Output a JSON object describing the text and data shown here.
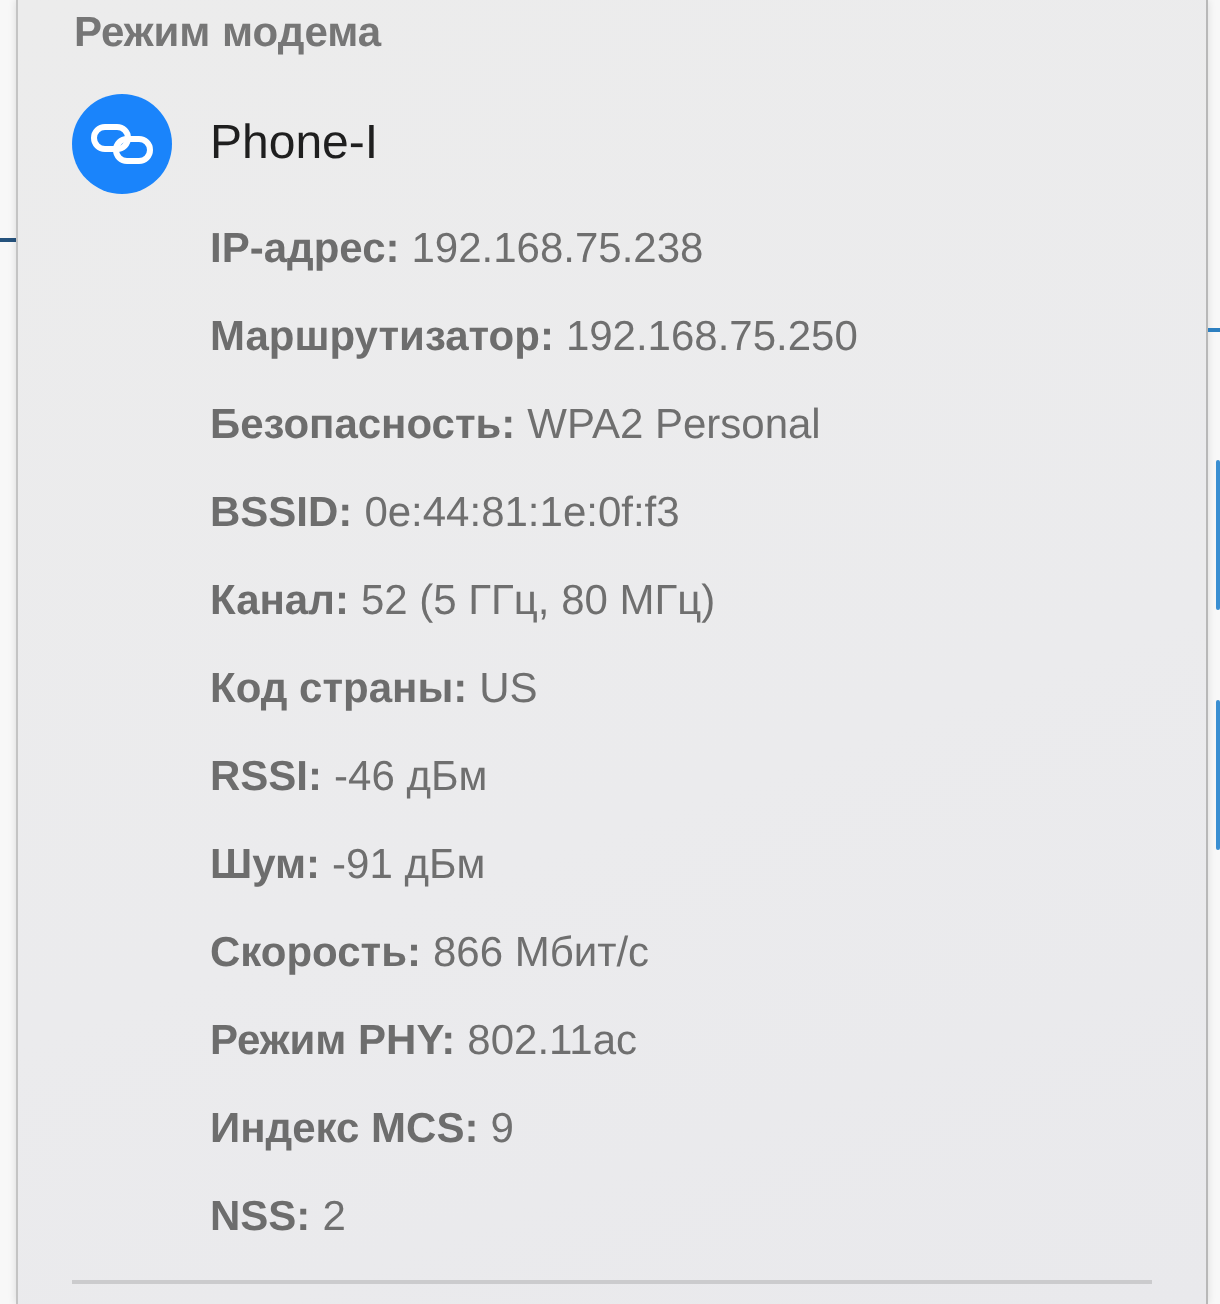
{
  "menu": {
    "section_title": "Режим модема",
    "network": {
      "name": "Phone-I",
      "connected": true
    },
    "details": [
      {
        "label": "IP-адрес:",
        "value": "192.168.75.238"
      },
      {
        "label": "Маршрутизатор:",
        "value": "192.168.75.250"
      },
      {
        "label": "Безопасность:",
        "value": "WPA2 Personal"
      },
      {
        "label": "BSSID:",
        "value": "0e:44:81:1e:0f:f3"
      },
      {
        "label": "Канал:",
        "value": "52 (5 ГГц, 80 МГц)"
      },
      {
        "label": "Код страны:",
        "value": "US"
      },
      {
        "label": "RSSI:",
        "value": "-46 дБм"
      },
      {
        "label": "Шум:",
        "value": "-91 дБм"
      },
      {
        "label": "Скорость:",
        "value": "866 Мбит/с"
      },
      {
        "label": "Режим PHY:",
        "value": "802.11ac"
      },
      {
        "label": "Индекс MCS:",
        "value": "9"
      },
      {
        "label": "NSS:",
        "value": "2"
      }
    ]
  }
}
